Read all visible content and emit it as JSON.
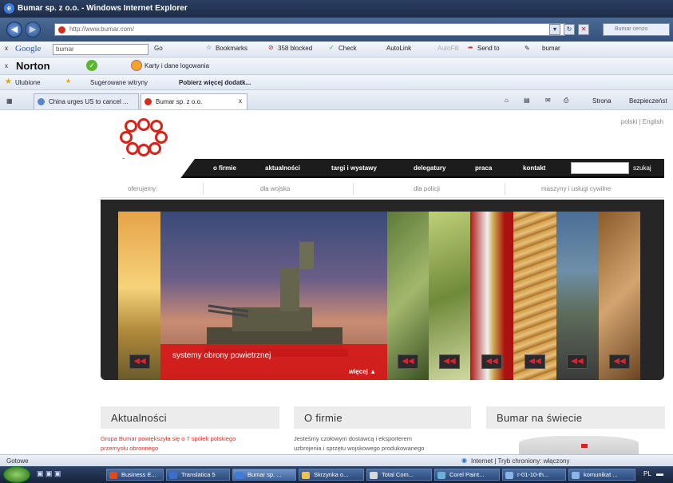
{
  "window": {
    "title": "Bumar sp. z o.o. - Windows Internet Explorer",
    "icon": "ie-icon"
  },
  "addressbar": {
    "url": "http://www.bumar.com/",
    "search_placeholder": "Bumar cenzo"
  },
  "google_toolbar": {
    "close": "x",
    "logo": "Google",
    "query": "bumar",
    "go": "Go",
    "bookmarks": "Bookmarks",
    "blocked": "358 blocked",
    "check": "Check",
    "autolink": "AutoLink",
    "autofill": "AutoFill",
    "sendto": "Send to",
    "term": "bumar"
  },
  "norton_toolbar": {
    "close": "x",
    "logo": "Norton",
    "cards": "Karty i dane logowania"
  },
  "favorites_bar": {
    "favorites": "Ulubione",
    "suggested": "Sugerowane witryny",
    "more": "Pobierz więcej dodatk..."
  },
  "tabs": [
    {
      "label": "China urges US to cancel ..."
    },
    {
      "label": "Bumar sp. z o.o."
    }
  ],
  "tab_close": "x",
  "command_bar": {
    "page": "Strona",
    "safety": "Bezpieczeńst"
  },
  "site": {
    "brand": "bumar",
    "lang": "polski | English",
    "nav": [
      "o firmie",
      "aktualności",
      "targi i wystawy",
      "delegatury",
      "praca",
      "kontakt"
    ],
    "search_label": "szukaj",
    "subnav": [
      "oferujemy:",
      "dla wojska",
      "dla policji",
      "maszyny i usługi cywilne"
    ],
    "slider_caption": "systemy obrony powietrznej",
    "slider_more": "więcej",
    "sections": [
      {
        "title": "Aktualności",
        "line1": "Grupa Bumar powiększyła się o 7 spółek polskiego",
        "line2": "przemysłu obronnego"
      },
      {
        "title": "O firmie",
        "line1": "Jesteśmy czołowym dostawcą i eksporterem",
        "line2": "uzbrojenia i sprzętu wojskowego produkowanego"
      },
      {
        "title": "Bumar na świecie",
        "line1": "",
        "line2": ""
      }
    ]
  },
  "statusbar": {
    "left": "Gotowe",
    "zone": "Internet | Tryb chroniony: włączony"
  },
  "taskbar": [
    {
      "label": "Business E..."
    },
    {
      "label": "Translatica 5"
    },
    {
      "label": "Bumar sp. ..."
    },
    {
      "label": "Skrzynka o..."
    },
    {
      "label": "Total Com..."
    },
    {
      "label": "Corel Paint..."
    },
    {
      "label": "r-01-10-th..."
    },
    {
      "label": "komunikat ..."
    }
  ],
  "tray": "PL"
}
